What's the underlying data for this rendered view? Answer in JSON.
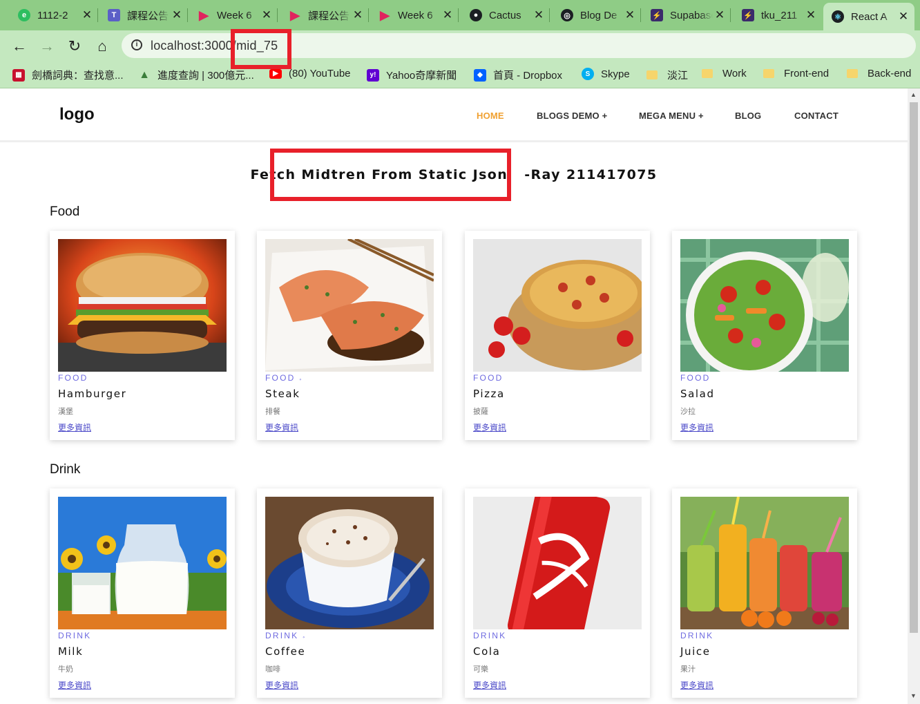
{
  "browser": {
    "tabs": [
      {
        "title": "1112-2",
        "icon": "evernote-icon",
        "color": "#2dbe60"
      },
      {
        "title": "課程公告",
        "icon": "teams-icon",
        "color": "#5b5fc7"
      },
      {
        "title": "Week 6",
        "icon": "play-icon",
        "color": "#e0245e"
      },
      {
        "title": "課程公告",
        "icon": "play-icon",
        "color": "#e0245e"
      },
      {
        "title": "Week 6",
        "icon": "play-icon",
        "color": "#e0245e"
      },
      {
        "title": "Cactus",
        "icon": "github-icon",
        "color": "#1b1f23"
      },
      {
        "title": "Blog De",
        "icon": "globe-icon",
        "color": "#1b1f23"
      },
      {
        "title": "Supabase",
        "icon": "supabase-icon",
        "color": "#3b2a6b"
      },
      {
        "title": "tku_211",
        "icon": "supabase-icon",
        "color": "#3b2a6b"
      },
      {
        "title": "React A",
        "icon": "react-icon",
        "color": "#1b1f23"
      }
    ],
    "url": {
      "host": "localhost:3000",
      "path": "mid_75"
    },
    "bookmarks": [
      {
        "label": "劍橋詞典：查找意...",
        "icon": "cambridge-icon",
        "color": "#c8102e"
      },
      {
        "label": "進度查詢 | 300億元...",
        "icon": "mountain-icon",
        "color": "#3a7d3a"
      },
      {
        "label": "(80) YouTube",
        "icon": "youtube-icon",
        "color": "#ff0000"
      },
      {
        "label": "Yahoo奇摩新聞",
        "icon": "yahoo-icon",
        "color": "#6001d2"
      },
      {
        "label": "首頁 - Dropbox",
        "icon": "dropbox-icon",
        "color": "#0061ff"
      },
      {
        "label": "Skype",
        "icon": "skype-icon",
        "color": "#00aff0"
      },
      {
        "label": "淡江",
        "icon": "folder-icon",
        "color": "#f6d56c"
      },
      {
        "label": "Work",
        "icon": "folder-icon",
        "color": "#f6d56c"
      },
      {
        "label": "Front-end",
        "icon": "folder-icon",
        "color": "#f6d56c"
      },
      {
        "label": "Back-end",
        "icon": "folder-icon",
        "color": "#f6d56c"
      }
    ]
  },
  "site": {
    "logo": "logo",
    "menu": [
      "HOME",
      "BLOGS DEMO +",
      "MEGA MENU +",
      "BLOG",
      "CONTACT"
    ],
    "title_main": "Fetch Midtren From Static Json",
    "title_suffix": "-Ray 211417075",
    "accent": "#f0a030",
    "highlight_color": "#e8202a"
  },
  "sections": [
    {
      "title": "Food",
      "items": [
        {
          "category": "FOOD",
          "name": "Hamburger",
          "zh": "漢堡",
          "link": "更多資訊",
          "image": "hamburger-image"
        },
        {
          "category": "FOOD 𝆹",
          "name": "Steak",
          "zh": "排餐",
          "link": "更多資訊",
          "image": "steak-image"
        },
        {
          "category": "FOOD",
          "name": "Pizza",
          "zh": "披薩",
          "link": "更多資訊",
          "image": "pizza-image"
        },
        {
          "category": "FOOD",
          "name": "Salad",
          "zh": "沙拉",
          "link": "更多資訊",
          "image": "salad-image"
        }
      ]
    },
    {
      "title": "Drink",
      "items": [
        {
          "category": "DRINK",
          "name": "Milk",
          "zh": "牛奶",
          "link": "更多資訊",
          "image": "milk-image"
        },
        {
          "category": "DRINK 𝆹",
          "name": "Coffee",
          "zh": "咖啡",
          "link": "更多資訊",
          "image": "coffee-image"
        },
        {
          "category": "DRINK",
          "name": "Cola",
          "zh": "可樂",
          "link": "更多資訊",
          "image": "cola-image"
        },
        {
          "category": "DRINK",
          "name": "Juice",
          "zh": "果汁",
          "link": "更多資訊",
          "image": "juice-image"
        }
      ]
    }
  ]
}
